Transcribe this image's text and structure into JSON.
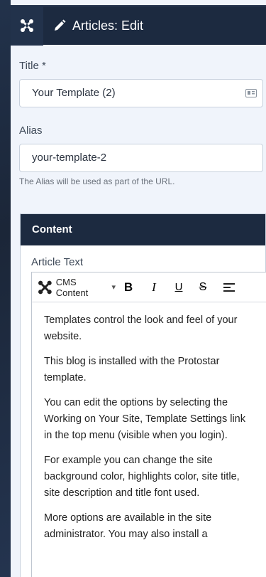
{
  "header": {
    "title": "Articles: Edit",
    "logo_icon": "joomla-icon",
    "edit_icon": "pencil-icon"
  },
  "title_field": {
    "label": "Title *",
    "value": "Your Template (2)"
  },
  "alias_field": {
    "label": "Alias",
    "value": "your-template-2",
    "hint": "The Alias will be used as part of the URL."
  },
  "content": {
    "header": "Content",
    "article_label": "Article Text",
    "toolbar": {
      "cms_content": "CMS Content",
      "bold": "B",
      "italic": "I",
      "underline": "U",
      "strike": "S"
    },
    "paragraphs": [
      "Templates control the look and feel of your website.",
      "This blog is installed with the Protostar template.",
      "You can edit the options by selecting the Working on Your Site, Template Settings link in the top menu (visible when you login).",
      "For example you can change the site background color, highlights color, site title, site description and title font used.",
      "More options are available in the site administrator. You may also install a"
    ]
  }
}
